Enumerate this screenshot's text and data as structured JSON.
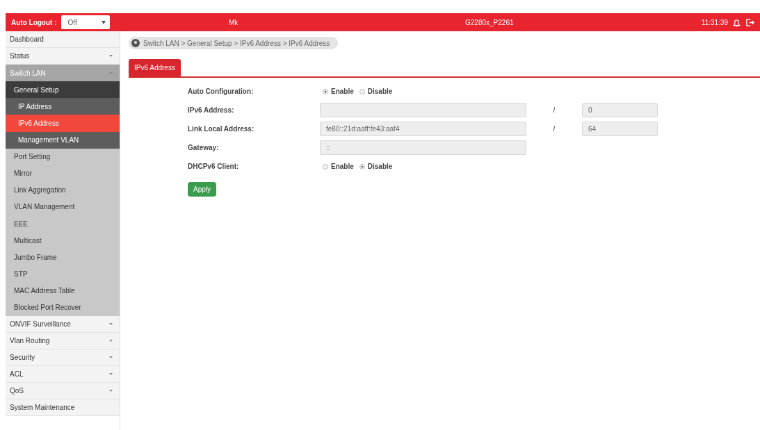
{
  "header": {
    "auto_logout": {
      "label": "Auto Logout :",
      "value": "Off"
    },
    "user": "Mk",
    "model": "G2280x_P2261",
    "time": "11:31:39"
  },
  "sidebar": {
    "items": [
      {
        "label": "Dashboard",
        "expandable": false,
        "expanded": false,
        "selected": false
      },
      {
        "label": "Status",
        "expandable": true,
        "expanded": false,
        "selected": false
      },
      {
        "label": "Switch LAN",
        "expandable": true,
        "expanded": true,
        "selected": false,
        "children": [
          {
            "label": "General Setup",
            "expanded": true,
            "selected": false,
            "children": [
              {
                "label": "IP Address",
                "selected": false
              },
              {
                "label": "IPv6 Address",
                "selected": true
              },
              {
                "label": "Management VLAN",
                "selected": false
              }
            ]
          },
          {
            "label": "Port Setting",
            "selected": false
          },
          {
            "label": "Mirror",
            "selected": false
          },
          {
            "label": "Link Aggregation",
            "selected": false
          },
          {
            "label": "VLAN Management",
            "selected": false
          },
          {
            "label": "EEE",
            "selected": false
          },
          {
            "label": "Multicast",
            "selected": false
          },
          {
            "label": "Jumbo Frame",
            "selected": false
          },
          {
            "label": "STP",
            "selected": false
          },
          {
            "label": "MAC Address Table",
            "selected": false
          },
          {
            "label": "Blocked Port Recover",
            "selected": false
          }
        ]
      },
      {
        "label": "ONVIF Surveillance",
        "expandable": true,
        "expanded": false,
        "selected": false
      },
      {
        "label": "Vlan Routing",
        "expandable": true,
        "expanded": false,
        "selected": false
      },
      {
        "label": "Security",
        "expandable": true,
        "expanded": false,
        "selected": false
      },
      {
        "label": "ACL",
        "expandable": true,
        "expanded": false,
        "selected": false
      },
      {
        "label": "QoS",
        "expandable": true,
        "expanded": false,
        "selected": false
      },
      {
        "label": "System Maintenance",
        "expandable": false,
        "expanded": false,
        "selected": false
      }
    ]
  },
  "breadcrumb": "Switch LAN > General Setup > IPv6 Address  > IPv6 Address",
  "tabs": [
    {
      "label": "IPv6 Address",
      "selected": true
    }
  ],
  "form": {
    "rows": [
      {
        "kind": "radio",
        "label": "Auto Configuration:",
        "options": [
          {
            "label": "Enable",
            "selected": true
          },
          {
            "label": "Disable",
            "selected": false
          }
        ]
      },
      {
        "kind": "address",
        "label": "IPv6 Address:",
        "separator": "/",
        "prefix": "0"
      },
      {
        "kind": "address",
        "label": "Link Local Address:",
        "value": "fe80::21d:aaff:fe43:aaf4",
        "separator": "/",
        "prefix": "64"
      },
      {
        "kind": "address",
        "label": "Gateway:",
        "placeholder": "::"
      },
      {
        "kind": "radio",
        "label": "DHCPv6 Client:",
        "options": [
          {
            "label": "Enable",
            "selected": false
          },
          {
            "label": "Disable",
            "selected": true
          }
        ]
      }
    ],
    "apply": "Apply"
  }
}
